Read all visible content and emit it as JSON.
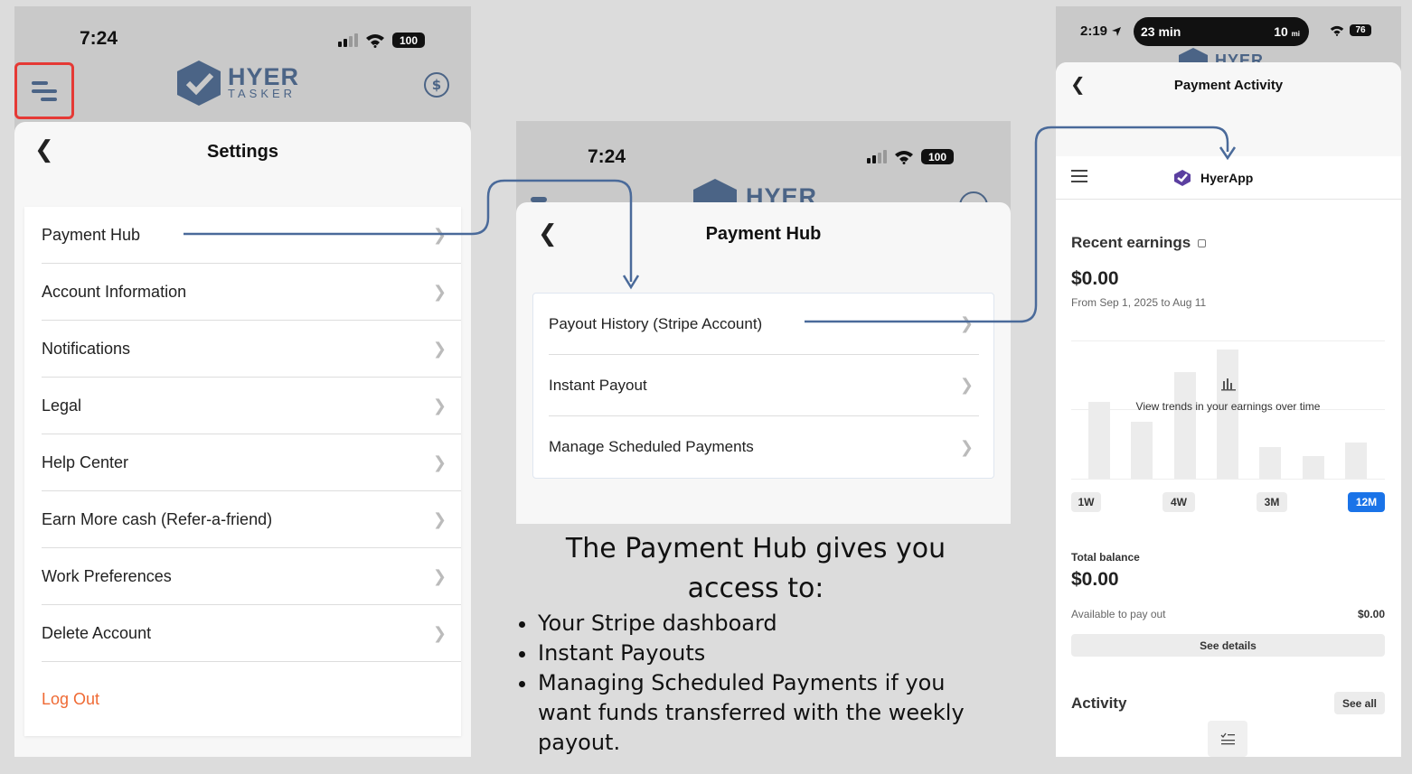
{
  "left_phone": {
    "status_time": "7:24",
    "battery": "100",
    "logo": {
      "main": "HYER",
      "sub": "TASKER"
    },
    "sheet_title": "Settings",
    "items": [
      {
        "label": "Payment Hub"
      },
      {
        "label": "Account Information"
      },
      {
        "label": "Notifications"
      },
      {
        "label": "Legal"
      },
      {
        "label": "Help Center"
      },
      {
        "label": "Earn More cash (Refer-a-friend)"
      },
      {
        "label": "Work Preferences"
      },
      {
        "label": "Delete Account"
      }
    ],
    "logout": "Log Out"
  },
  "middle_phone": {
    "status_time": "7:24",
    "battery": "100",
    "logo_partial": "HYER",
    "sheet_title": "Payment Hub",
    "items": [
      {
        "label": "Payout History (Stripe Account)"
      },
      {
        "label": "Instant Payout"
      },
      {
        "label": "Manage Scheduled Payments"
      }
    ]
  },
  "caption": {
    "heading": "The Payment Hub gives you access to:",
    "bullets": [
      "Your Stripe dashboard",
      "Instant Payouts",
      "Managing Scheduled Payments if you want funds transferred with the weekly payout."
    ]
  },
  "right_phone": {
    "status_time": "2:19",
    "island_left": "23 min",
    "island_right": "10",
    "island_unit": "mi",
    "battery": "76",
    "logo_partial": "HYER",
    "sheet_title": "Payment Activity",
    "app_name": "HyerApp",
    "recent_earnings": {
      "title": "Recent earnings",
      "amount": "$0.00",
      "range": "From Sep 1, 2025 to Aug 11",
      "empty_text": "View trends in your earnings over time",
      "bars": [
        0.58,
        0.43,
        0.8,
        0.97,
        0.24,
        0.17,
        0.27
      ],
      "periods": [
        {
          "label": "1W",
          "active": false
        },
        {
          "label": "4W",
          "active": false
        },
        {
          "label": "3M",
          "active": false
        },
        {
          "label": "12M",
          "active": true
        }
      ]
    },
    "balance": {
      "title": "Total balance",
      "amount": "$0.00",
      "available_label": "Available to pay out",
      "available_value": "$0.00",
      "details_button": "See details"
    },
    "activity": {
      "title": "Activity",
      "see_all": "See all"
    },
    "accent": "#1a73e8"
  },
  "colors": {
    "connector": "#4a6a9a",
    "logout": "#ef6a34",
    "highlight": "#e53935",
    "brand": "#4b6486"
  }
}
